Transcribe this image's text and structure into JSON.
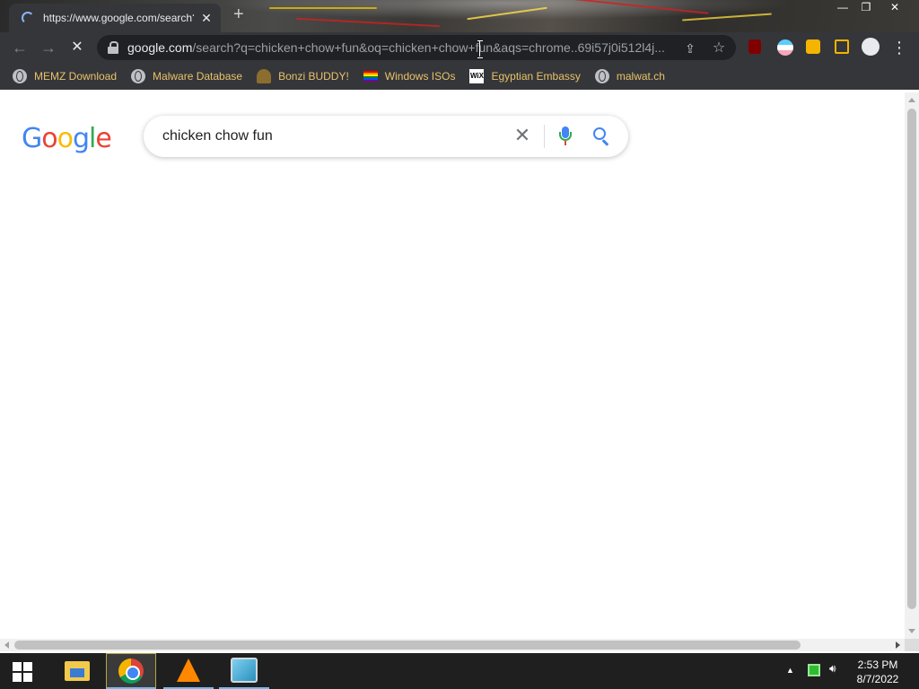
{
  "browser": {
    "tab": {
      "title": "https://www.google.com/search?q"
    },
    "window_controls": [
      "—",
      "❐",
      "✕"
    ],
    "omnibox": {
      "host": "google.com",
      "path": "/search?q=chicken+chow+fun&oq=chicken+chow+fun&aqs=chrome..69i57j0i512l4j..."
    },
    "bookmarks": [
      {
        "label": "MEMZ Download",
        "icon": "globe-icon"
      },
      {
        "label": "Malware Database",
        "icon": "globe-icon"
      },
      {
        "label": "Bonzi BUDDY!",
        "icon": "bonzi-icon"
      },
      {
        "label": "Windows ISOs",
        "icon": "rainbow-flag-icon"
      },
      {
        "label": "Egyptian Embassy",
        "icon": "wix-icon"
      },
      {
        "label": "malwat.ch",
        "icon": "globe-icon"
      }
    ],
    "wix_icon_text": "WiX"
  },
  "page": {
    "logo": [
      "G",
      "o",
      "o",
      "g",
      "l",
      "e"
    ],
    "logo_colors": [
      "#4285f4",
      "#ea4335",
      "#fbbc05",
      "#4285f4",
      "#34a853",
      "#ea4335"
    ],
    "search": {
      "query": "chicken chow fun",
      "clear_symbol": "✕"
    }
  },
  "taskbar": {
    "clock_time": "2:53 PM",
    "clock_date": "8/7/2022"
  }
}
